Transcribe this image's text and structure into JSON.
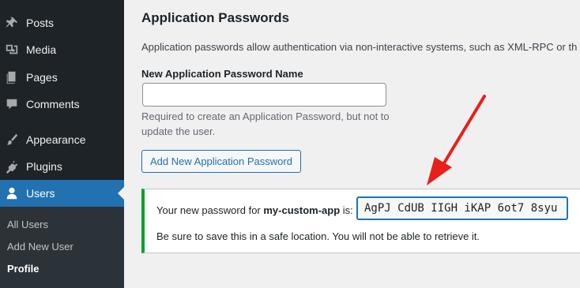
{
  "sidebar": {
    "items": [
      {
        "label": "Posts",
        "icon": "pushpin-icon"
      },
      {
        "label": "Media",
        "icon": "media-icon"
      },
      {
        "label": "Pages",
        "icon": "pages-icon"
      },
      {
        "label": "Comments",
        "icon": "comment-icon"
      },
      {
        "label": "Appearance",
        "icon": "brush-icon"
      },
      {
        "label": "Plugins",
        "icon": "plug-icon"
      },
      {
        "label": "Users",
        "icon": "user-icon",
        "active": true
      }
    ],
    "submenu": [
      {
        "label": "All Users"
      },
      {
        "label": "Add New User"
      },
      {
        "label": "Profile",
        "current": true
      }
    ]
  },
  "section": {
    "title": "Application Passwords",
    "description": "Application passwords allow authentication via non-interactive systems, such as XML-RPC or th"
  },
  "form": {
    "name_label": "New Application Password Name",
    "name_value": "",
    "help_text": "Required to create an Application Password, but not to update the user.",
    "add_button": "Add New Application Password"
  },
  "notice": {
    "prefix": "Your new password for ",
    "app_name": "my-custom-app",
    "suffix": " is:",
    "password": "AgPJ CdUB IIGH iKAP 6ot7 8syu",
    "warning": "Be sure to save this in a safe location. You will not be able to retrieve it."
  },
  "colors": {
    "sidebar_bg": "#1d2327",
    "active_blue": "#2271b1",
    "success_green": "#00a32a",
    "annotation_arrow": "#e8201a"
  }
}
